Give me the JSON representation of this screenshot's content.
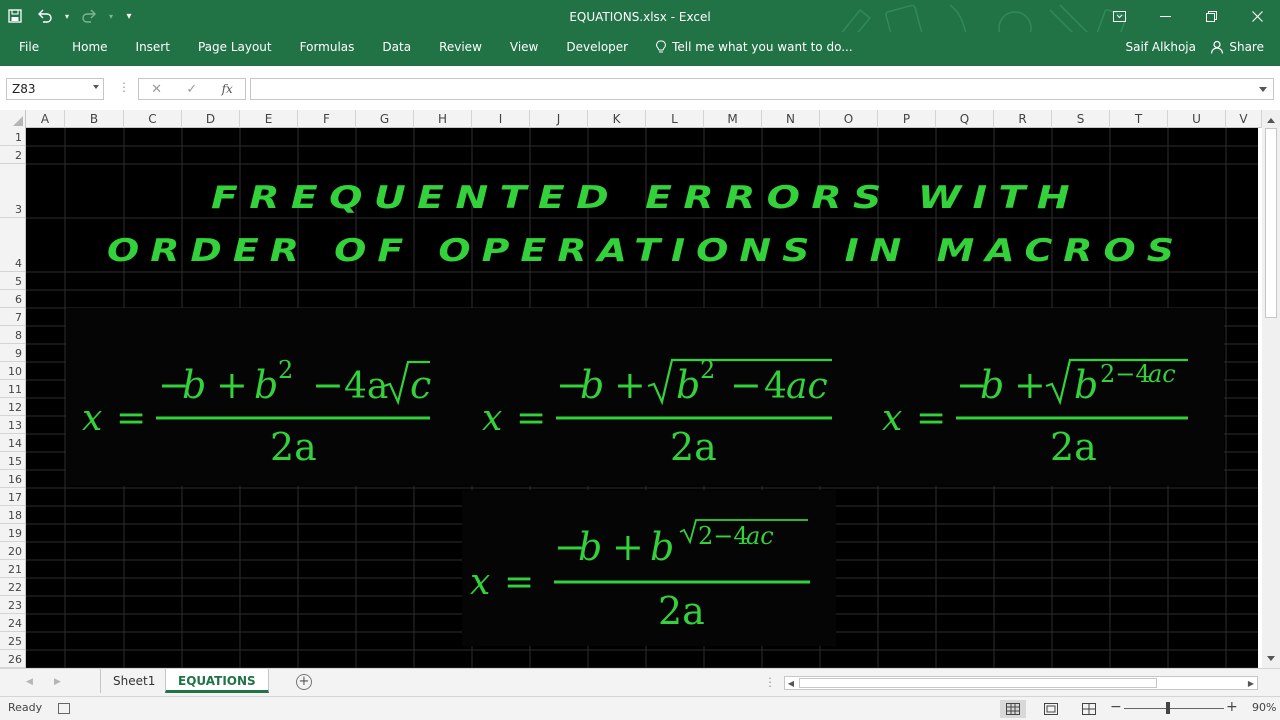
{
  "window": {
    "title": "EQUATIONS.xlsx - Excel",
    "qat_customize": "▾"
  },
  "ribbon": {
    "tabs": [
      "File",
      "Home",
      "Insert",
      "Page Layout",
      "Formulas",
      "Data",
      "Review",
      "View",
      "Developer"
    ],
    "tell_me": "Tell me what you want to do...",
    "account_name": "Saif Alkhoja",
    "share_label": "Share"
  },
  "formula_bar": {
    "name_box": "Z83",
    "fx_label": "fx",
    "formula": ""
  },
  "grid": {
    "columns": [
      "A",
      "B",
      "C",
      "D",
      "E",
      "F",
      "G",
      "H",
      "I",
      "J",
      "K",
      "L",
      "M",
      "N",
      "O",
      "P",
      "Q",
      "R",
      "S",
      "T",
      "U",
      "V"
    ],
    "rows": [
      "1",
      "2",
      "3",
      "4",
      "5",
      "6",
      "7",
      "8",
      "9",
      "10",
      "11",
      "12",
      "13",
      "14",
      "15",
      "16",
      "17",
      "18",
      "19",
      "20",
      "21",
      "22",
      "23",
      "24",
      "25",
      "26"
    ],
    "background": "#000000",
    "accent": "#33d13a"
  },
  "content": {
    "heading_line1": "FREQUENTED ERRORS WITH",
    "heading_line2": "ORDER OF OPERATIONS IN MACROS",
    "equations": [
      {
        "lhs": "x =",
        "num": "−b + b² − 4a√c",
        "den": "2a"
      },
      {
        "lhs": "x =",
        "num": "−b + √(b² − 4ac)",
        "den": "2a"
      },
      {
        "lhs": "x =",
        "num": "−b + √(b^(2−4ac))",
        "den": "2a"
      },
      {
        "lhs": "x =",
        "num": "−b + b^√(2−4ac)",
        "den": "2a"
      }
    ]
  },
  "sheets": {
    "tabs": [
      "Sheet1",
      "EQUATIONS"
    ],
    "active": "EQUATIONS",
    "add_label": "+"
  },
  "status": {
    "ready": "Ready",
    "zoom": "90%"
  }
}
